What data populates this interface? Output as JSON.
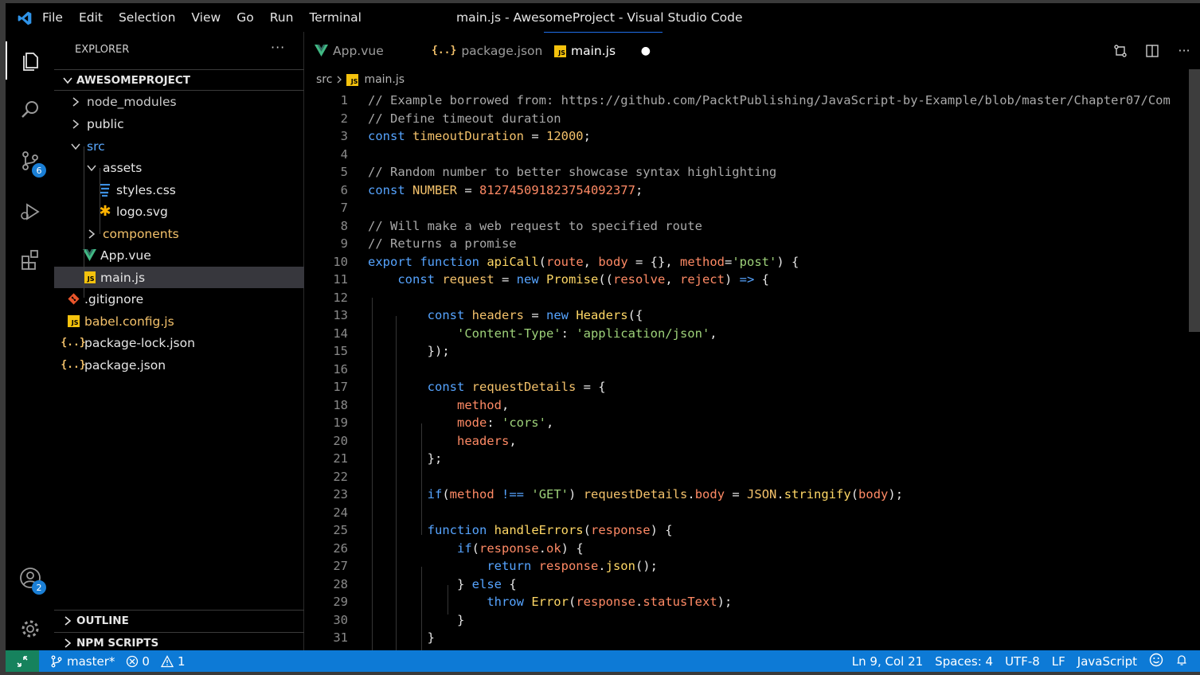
{
  "window": {
    "title": "main.js - AwesomeProject - Visual Studio Code"
  },
  "menu": [
    "File",
    "Edit",
    "Selection",
    "View",
    "Go",
    "Run",
    "Terminal"
  ],
  "activity": {
    "scm_badge": "6",
    "accounts_badge": "2"
  },
  "sidebar": {
    "header": "EXPLORER",
    "more": "···",
    "project": "AWESOMEPROJECT",
    "items": [
      {
        "label": "node_modules",
        "kind": "folder",
        "color": "#cccccc"
      },
      {
        "label": "public",
        "kind": "folder",
        "color": "#e6e6e6"
      },
      {
        "label": "src",
        "kind": "folder",
        "color": "#5aa9ff"
      },
      {
        "label": "assets",
        "kind": "folder",
        "color": "#e6e6e6"
      },
      {
        "label": "styles.css",
        "kind": "css",
        "color": "#e6e6e6"
      },
      {
        "label": "logo.svg",
        "kind": "svg",
        "color": "#e6e6e6"
      },
      {
        "label": "components",
        "kind": "folder",
        "color": "#f4c26b"
      },
      {
        "label": "App.vue",
        "kind": "vue",
        "color": "#e6e6e6"
      },
      {
        "label": "main.js",
        "kind": "js",
        "color": "#e6e6e6"
      },
      {
        "label": ".gitignore",
        "kind": "git",
        "color": "#e6e6e6"
      },
      {
        "label": "babel.config.js",
        "kind": "js",
        "color": "#f4c26b"
      },
      {
        "label": "package-lock.json",
        "kind": "json",
        "color": "#e6e6e6"
      },
      {
        "label": "package.json",
        "kind": "json",
        "color": "#e6e6e6"
      }
    ],
    "outline": "OUTLINE",
    "npm": "NPM SCRIPTS"
  },
  "tabs": [
    {
      "label": "App.vue",
      "kind": "vue",
      "active": false
    },
    {
      "label": "package.json",
      "kind": "json",
      "active": false
    },
    {
      "label": "main.js",
      "kind": "js",
      "active": true,
      "dirty": "●"
    }
  ],
  "breadcrumb": {
    "folder": "src",
    "file": "main.js"
  },
  "code": [
    [
      [
        "c",
        "// Example borrowed from: https://github.com/PacktPublishing/JavaScript-by-Example/blob/master/Chapter07/Com"
      ]
    ],
    [
      [
        "c",
        "// Define timeout duration"
      ]
    ],
    [
      [
        "k",
        "const "
      ],
      [
        "n",
        "timeoutDuration"
      ],
      [
        "p",
        " = "
      ],
      [
        "n",
        "12000"
      ],
      [
        "p",
        ";"
      ]
    ],
    [],
    [
      [
        "c",
        "// Random number to better showcase syntax highlighting"
      ]
    ],
    [
      [
        "k",
        "const "
      ],
      [
        "n",
        "NUMBER"
      ],
      [
        "p",
        " = "
      ],
      [
        "v",
        "812745091823754092377"
      ],
      [
        "p",
        ";"
      ]
    ],
    [],
    [
      [
        "c",
        "// Will make a web request to specified route"
      ]
    ],
    [
      [
        "c",
        "// Returns a promise"
      ]
    ],
    [
      [
        "k",
        "export "
      ],
      [
        "k",
        "function "
      ],
      [
        "f",
        "apiCall"
      ],
      [
        "p",
        "("
      ],
      [
        "v",
        "route"
      ],
      [
        "p",
        ", "
      ],
      [
        "v",
        "body"
      ],
      [
        "p",
        " = {}, "
      ],
      [
        "v",
        "method"
      ],
      [
        "p",
        "="
      ],
      [
        "s",
        "'post'"
      ],
      [
        "p",
        ") {"
      ]
    ],
    [
      [
        "p",
        "    "
      ],
      [
        "k",
        "const "
      ],
      [
        "n",
        "request"
      ],
      [
        "p",
        " = "
      ],
      [
        "k",
        "new "
      ],
      [
        "f",
        "Promise"
      ],
      [
        "p",
        "(("
      ],
      [
        "v",
        "resolve"
      ],
      [
        "p",
        ", "
      ],
      [
        "v",
        "reject"
      ],
      [
        "p",
        ") "
      ],
      [
        "k",
        "=>"
      ],
      [
        "p",
        " {"
      ]
    ],
    [],
    [
      [
        "p",
        "        "
      ],
      [
        "k",
        "const "
      ],
      [
        "n",
        "headers"
      ],
      [
        "p",
        " = "
      ],
      [
        "k",
        "new "
      ],
      [
        "f",
        "Headers"
      ],
      [
        "p",
        "({"
      ]
    ],
    [
      [
        "p",
        "            "
      ],
      [
        "s",
        "'Content-Type'"
      ],
      [
        "p",
        ": "
      ],
      [
        "s",
        "'application/json'"
      ],
      [
        "p",
        ","
      ]
    ],
    [
      [
        "p",
        "        });"
      ]
    ],
    [],
    [
      [
        "p",
        "        "
      ],
      [
        "k",
        "const "
      ],
      [
        "n",
        "requestDetails"
      ],
      [
        "p",
        " = {"
      ]
    ],
    [
      [
        "p",
        "            "
      ],
      [
        "v",
        "method"
      ],
      [
        "p",
        ","
      ]
    ],
    [
      [
        "p",
        "            "
      ],
      [
        "v",
        "mode"
      ],
      [
        "p",
        ": "
      ],
      [
        "s",
        "'cors'"
      ],
      [
        "p",
        ","
      ]
    ],
    [
      [
        "p",
        "            "
      ],
      [
        "v",
        "headers"
      ],
      [
        "p",
        ","
      ]
    ],
    [
      [
        "p",
        "        };"
      ]
    ],
    [],
    [
      [
        "p",
        "        "
      ],
      [
        "k",
        "if"
      ],
      [
        "p",
        "("
      ],
      [
        "v",
        "method"
      ],
      [
        "p",
        " "
      ],
      [
        "k",
        "!=="
      ],
      [
        "p",
        " "
      ],
      [
        "s",
        "'GET'"
      ],
      [
        "p",
        ") "
      ],
      [
        "n",
        "requestDetails"
      ],
      [
        "p",
        "."
      ],
      [
        "v",
        "body"
      ],
      [
        "p",
        " = "
      ],
      [
        "n",
        "JSON"
      ],
      [
        "p",
        "."
      ],
      [
        "f",
        "stringify"
      ],
      [
        "p",
        "("
      ],
      [
        "v",
        "body"
      ],
      [
        "p",
        ");"
      ]
    ],
    [],
    [
      [
        "p",
        "        "
      ],
      [
        "k",
        "function "
      ],
      [
        "f",
        "handleErrors"
      ],
      [
        "p",
        "("
      ],
      [
        "v",
        "response"
      ],
      [
        "p",
        ") {"
      ]
    ],
    [
      [
        "p",
        "            "
      ],
      [
        "k",
        "if"
      ],
      [
        "p",
        "("
      ],
      [
        "v",
        "response"
      ],
      [
        "p",
        "."
      ],
      [
        "v",
        "ok"
      ],
      [
        "p",
        ") {"
      ]
    ],
    [
      [
        "p",
        "                "
      ],
      [
        "k",
        "return "
      ],
      [
        "v",
        "response"
      ],
      [
        "p",
        "."
      ],
      [
        "f",
        "json"
      ],
      [
        "p",
        "();"
      ]
    ],
    [
      [
        "p",
        "            } "
      ],
      [
        "k",
        "else"
      ],
      [
        "p",
        " {"
      ]
    ],
    [
      [
        "p",
        "                "
      ],
      [
        "k",
        "throw "
      ],
      [
        "f",
        "Error"
      ],
      [
        "p",
        "("
      ],
      [
        "v",
        "response"
      ],
      [
        "p",
        "."
      ],
      [
        "v",
        "statusText"
      ],
      [
        "p",
        ");"
      ]
    ],
    [
      [
        "p",
        "            }"
      ]
    ],
    [
      [
        "p",
        "        }"
      ]
    ],
    [
      [
        "p",
        ""
      ]
    ]
  ],
  "status": {
    "branch": "master*",
    "errors": "0",
    "warnings": "1",
    "position": "Ln 9, Col 21",
    "spaces": "Spaces: 4",
    "encoding": "UTF-8",
    "eol": "LF",
    "language": "JavaScript"
  },
  "colors": {
    "accent": "#0d7ad6",
    "remote": "#16825d",
    "selection": "#37373d"
  }
}
